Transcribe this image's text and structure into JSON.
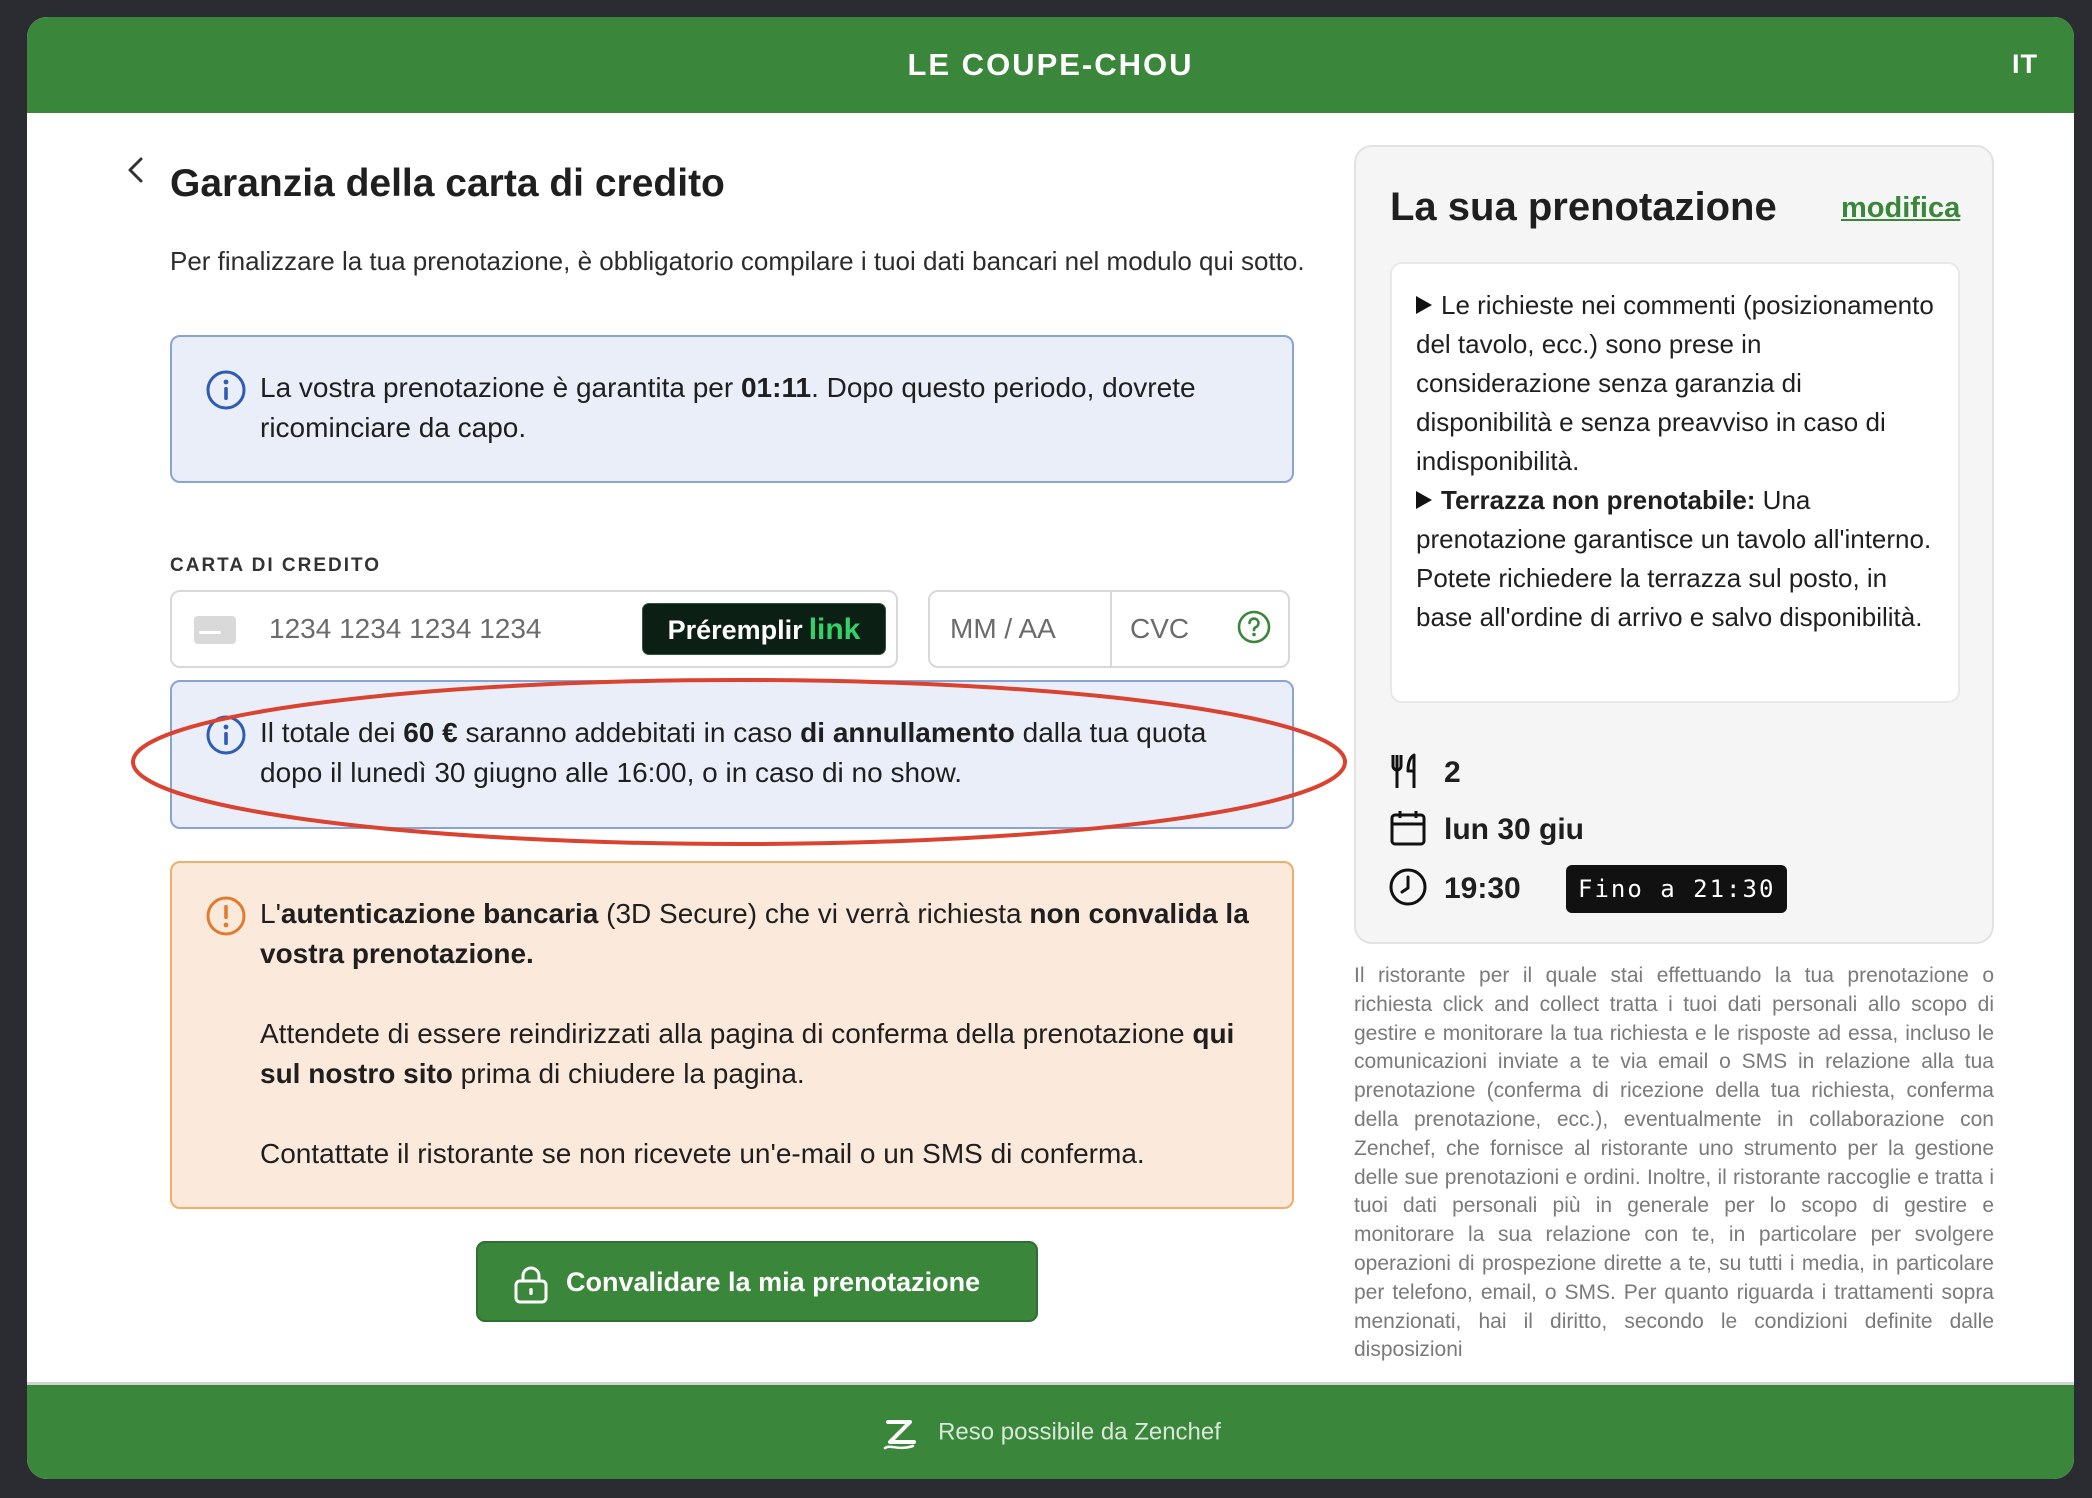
{
  "header": {
    "brand": "LE COUPE-CHOU",
    "language": "IT"
  },
  "page": {
    "title": "Garanzia della carta di credito",
    "intro": "Per finalizzare la tua prenotazione, è obbligatorio compilare i tuoi dati bancari nel modulo qui sotto."
  },
  "timer_notice": {
    "prefix": "La vostra prenotazione è garantita per ",
    "time": "01:11",
    "suffix": ". Dopo questo periodo, dovrete ricominciare da capo."
  },
  "card_form": {
    "label": "CARTA DI CREDITO",
    "card_number_placeholder": "1234 1234 1234 1234",
    "autofill_label": "Préremplir",
    "autofill_link": "link",
    "expiry_placeholder": "MM / AA",
    "cvc_placeholder": "CVC"
  },
  "charge_notice": {
    "t1": "Il totale dei ",
    "amount": "60 €",
    "t2": " saranno addebitati in caso ",
    "bold": "di annullamento",
    "t3": " dalla tua quota dopo il lunedì 30 giugno alle 16:00, o in caso di no show."
  },
  "auth_notice": {
    "p1_a": "L'",
    "p1_b": "autenticazione bancaria",
    "p1_c": " (3D Secure) che vi verrà richiesta ",
    "p1_d": "non convalida la vostra prenotazione.",
    "p2_a": "Attendete di essere reindirizzati alla pagina di conferma della prenotazione ",
    "p2_b": "qui sul nostro sito",
    "p2_c": " prima di chiudere la pagina.",
    "p3": "Contattate il ristorante se non ricevete un'e-mail o un SMS di conferma."
  },
  "submit_label": "Convalidare la mia prenotazione",
  "reservation": {
    "title": "La sua prenotazione",
    "edit_label": "modifica",
    "note1": "Le richieste nei commenti (posizionamento del tavolo, ecc.) sono prese in considerazione senza garanzia di disponibilità e senza preavviso in caso di indisponibilità.",
    "note2_bold": "Terrazza non prenotabile:",
    "note2_text": " Una prenotazione garantisce un tavolo all'interno. Potete richiedere la terrazza sul posto, in base all'ordine di arrivo e salvo disponibilità.",
    "guests": "2",
    "date": "lun 30 giu",
    "time": "19:30",
    "until": "Fino a 21:30"
  },
  "legal_text": "Il ristorante per il quale stai effettuando la tua prenotazione o richiesta click and collect tratta i tuoi dati personali allo scopo di gestire e monitorare la tua richiesta e le risposte ad essa, incluso le comunicazioni inviate a te via email o SMS in relazione alla tua prenotazione (conferma di ricezione della tua richiesta, conferma della prenotazione, ecc.), eventualmente in collaborazione con Zenchef, che fornisce al ristorante uno strumento per la gestione delle sue prenotazioni e ordini. Inoltre, il ristorante raccoglie e tratta i tuoi dati personali più in generale per lo scopo di gestire e monitorare la sua relazione con te, in particolare per svolgere operazioni di prospezione dirette a te, su tutti i media, in particolare per telefono, email, o SMS. Per quanto riguarda i trattamenti sopra menzionati, hai il diritto, secondo le condizioni definite dalle disposizioni",
  "footer": {
    "powered_by": "Reso possibile da Zenchef"
  },
  "colors": {
    "brand_green": "#3a863b",
    "info_bg": "#e9eef9",
    "warning_bg": "#fbeadc",
    "annotation_red": "#d9432f"
  }
}
